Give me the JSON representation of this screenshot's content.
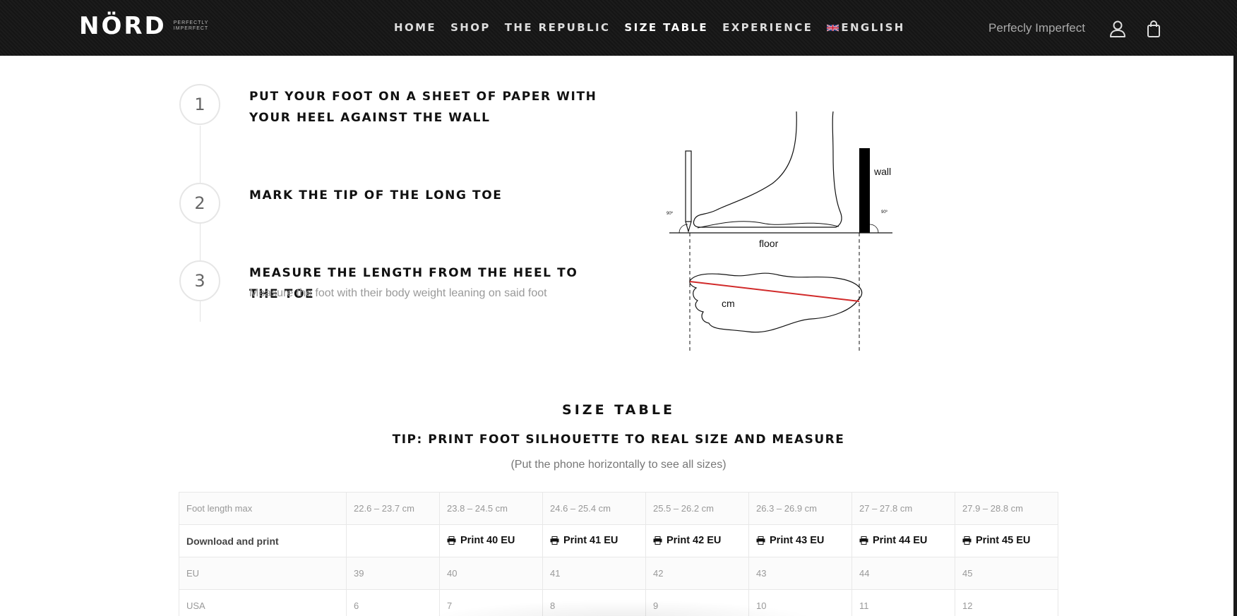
{
  "header": {
    "logo_text": "NÖRD",
    "logo_tagline": "PERFECTLY IMPERFECT",
    "nav": [
      {
        "label": "HOME",
        "active": false
      },
      {
        "label": "SHOP",
        "active": false
      },
      {
        "label": "THE REPUBLIC",
        "active": false
      },
      {
        "label": "SIZE TABLE",
        "active": true
      },
      {
        "label": "EXPERIENCE",
        "active": false
      },
      {
        "label": "ENGLISH",
        "active": false
      }
    ],
    "tagline": "Perfecly Imperfect",
    "icons": [
      "user-icon",
      "shopping-bag-icon"
    ]
  },
  "steps": [
    {
      "number": "1",
      "title": "Put your foot on a sheet of paper with your heel against the wall",
      "subtitle": ""
    },
    {
      "number": "2",
      "title": "Mark the tip of the long toe",
      "subtitle": ""
    },
    {
      "number": "3",
      "title": "Measure the length from the heel to the toe",
      "subtitle": "Measure the foot with their body weight leaning on said foot"
    }
  ],
  "diagram": {
    "wall_label": "wall",
    "floor_label": "floor",
    "cm_label": "cm",
    "angle_left": "90º",
    "angle_right": "90º"
  },
  "size_section": {
    "title": "Size Table",
    "tip": "Tip: print foot silhouette to real size and measure",
    "note": "(Put the phone horizontally to see all sizes)"
  },
  "size_table": {
    "rows": [
      {
        "label": "Foot length max",
        "cells": [
          "22.6 – 23.7 cm",
          "23.8 – 24.5 cm",
          "24.6 – 25.4 cm",
          "25.5 – 26.2 cm",
          "26.3 – 26.9 cm",
          "27 – 27.8 cm",
          "27.9 – 28.8 cm"
        ]
      },
      {
        "label": "Download and print",
        "cells": [
          "",
          "Print 40 EU",
          "Print 41 EU",
          "Print 42 EU",
          "Print 43 EU",
          "Print 44 EU",
          "Print 45 EU"
        ]
      },
      {
        "label": "EU",
        "cells": [
          "39",
          "40",
          "41",
          "42",
          "43",
          "44",
          "45"
        ]
      },
      {
        "label": "USA",
        "cells": [
          "6",
          "7",
          "8",
          "9",
          "10",
          "11",
          "12"
        ]
      }
    ]
  },
  "colors": {
    "header_bg": "#1a1a1a",
    "measure_line": "#d12a2a",
    "text_dark": "#111111"
  }
}
